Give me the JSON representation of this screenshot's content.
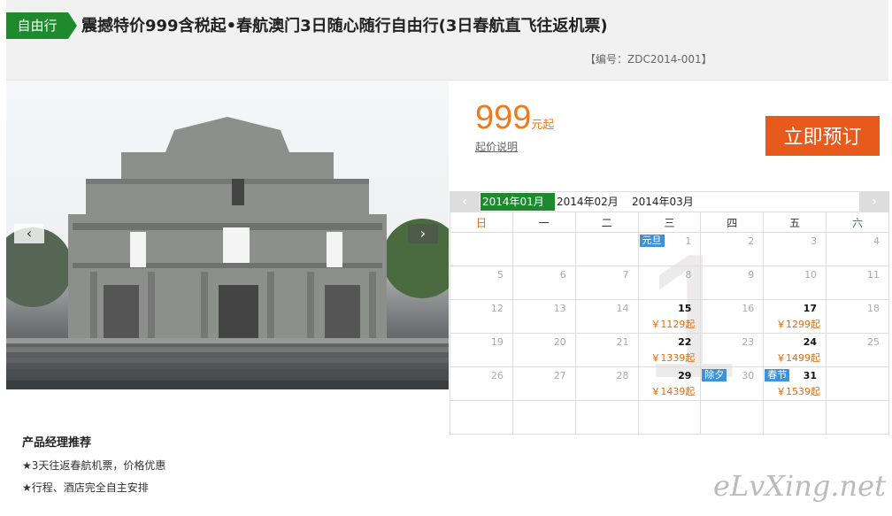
{
  "header": {
    "tag": "自由行",
    "title": "震撼特价999含税起•春航澳门3日随心随行自由行(3日春航直飞往返机票)",
    "code": "【编号：ZDC2014-001】"
  },
  "gallery": {
    "prev_icon": "‹",
    "next_icon": "›"
  },
  "pricing": {
    "price": "999",
    "unit": "元起",
    "explain_link": "起价说明",
    "book_button": "立即预订"
  },
  "calendar": {
    "nav_prev": "‹",
    "nav_next": "›",
    "months": [
      "2014年01月",
      "2014年02月",
      "2014年03月"
    ],
    "weekdays": [
      "日",
      "一",
      "二",
      "三",
      "四",
      "五",
      "六"
    ],
    "background_digit": "1",
    "weeks": [
      [
        {
          "day": ""
        },
        {
          "day": ""
        },
        {
          "day": ""
        },
        {
          "day": "1",
          "holiday": "元旦"
        },
        {
          "day": "2"
        },
        {
          "day": "3"
        },
        {
          "day": "4"
        }
      ],
      [
        {
          "day": "5"
        },
        {
          "day": "6"
        },
        {
          "day": "7"
        },
        {
          "day": "8"
        },
        {
          "day": "9"
        },
        {
          "day": "10"
        },
        {
          "day": "11"
        }
      ],
      [
        {
          "day": "12"
        },
        {
          "day": "13"
        },
        {
          "day": "14"
        },
        {
          "day": "15",
          "fare": "￥1129起"
        },
        {
          "day": "16"
        },
        {
          "day": "17",
          "fare": "￥1299起"
        },
        {
          "day": "18"
        }
      ],
      [
        {
          "day": "19"
        },
        {
          "day": "20"
        },
        {
          "day": "21"
        },
        {
          "day": "22",
          "fare": "￥1339起"
        },
        {
          "day": "23"
        },
        {
          "day": "24",
          "fare": "￥1499起"
        },
        {
          "day": "25"
        }
      ],
      [
        {
          "day": "26"
        },
        {
          "day": "27"
        },
        {
          "day": "28"
        },
        {
          "day": "29",
          "fare": "￥1439起"
        },
        {
          "day": "30",
          "holiday": "除夕"
        },
        {
          "day": "31",
          "holiday": "春节",
          "fare": "￥1539起"
        },
        {
          "day": ""
        }
      ],
      [
        {
          "day": ""
        },
        {
          "day": ""
        },
        {
          "day": ""
        },
        {
          "day": ""
        },
        {
          "day": ""
        },
        {
          "day": ""
        },
        {
          "day": ""
        }
      ]
    ]
  },
  "recommend": {
    "title": "产品经理推荐",
    "items": [
      "★3天往返春航机票，价格优惠",
      "★行程、酒店完全自主安排"
    ]
  },
  "watermark": "eLvXing.net",
  "colors": {
    "green": "#1e8a2e",
    "orange": "#e8591c",
    "price": "#f07a1a",
    "holiday": "#3e93d8"
  }
}
